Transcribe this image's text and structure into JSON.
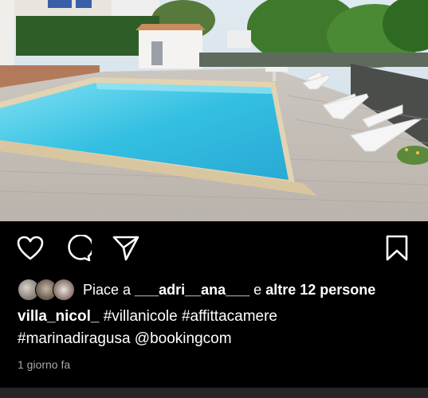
{
  "post": {
    "photo_alt": "swimming pool with white lounge chairs",
    "actions": {
      "like_icon": "heart-outline-icon",
      "comment_icon": "comment-bubble-icon",
      "share_icon": "paper-plane-icon",
      "save_icon": "bookmark-outline-icon"
    },
    "likes": {
      "prefix": "Piace a ",
      "first_user": "___adri__ana___",
      "connector": " e ",
      "others": "altre 12 persone"
    },
    "caption": {
      "username": "villa_nicol_",
      "text_line1": " #villanicole #affittacamere",
      "text_line2": "#marinadiragusa @bookingcom"
    },
    "timestamp": "1 giorno fa"
  },
  "colors": {
    "background": "#000000",
    "text": "#ffffff",
    "muted": "#a8a8a8",
    "pool": "#3fc3e3"
  }
}
